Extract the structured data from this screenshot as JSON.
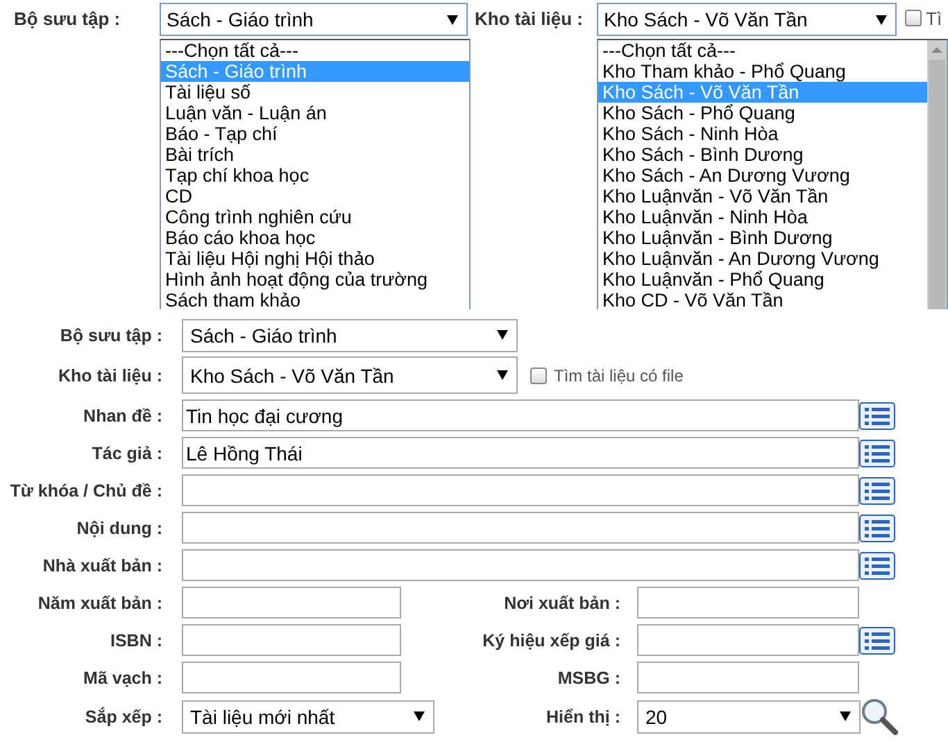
{
  "top": {
    "collection": {
      "label": "Bộ sưu tập :",
      "value": "Sách - Giáo trình",
      "options": [
        {
          "label": "---Chọn tất cả---",
          "selected": false
        },
        {
          "label": "Sách - Giáo trình",
          "selected": true
        },
        {
          "label": "Tài liệu số",
          "selected": false
        },
        {
          "label": "Luận văn - Luận án",
          "selected": false
        },
        {
          "label": "Báo - Tạp chí",
          "selected": false
        },
        {
          "label": "Bài trích",
          "selected": false
        },
        {
          "label": "Tạp chí khoa học",
          "selected": false
        },
        {
          "label": "CD",
          "selected": false
        },
        {
          "label": "Công trình nghiên cứu",
          "selected": false
        },
        {
          "label": "Báo cáo khoa học",
          "selected": false
        },
        {
          "label": "Tài liệu Hội nghị Hội thảo",
          "selected": false
        },
        {
          "label": "Hình ảnh hoạt động của trường",
          "selected": false
        },
        {
          "label": "Sách tham khảo",
          "selected": false
        }
      ]
    },
    "storage": {
      "label": "Kho tài liệu :",
      "value": "Kho Sách - Võ Văn Tần",
      "options": [
        {
          "label": "---Chọn tất cả---",
          "selected": false
        },
        {
          "label": "Kho Tham khảo - Phổ Quang",
          "selected": false
        },
        {
          "label": "Kho Sách - Võ Văn Tần",
          "selected": true
        },
        {
          "label": "Kho Sách - Phổ Quang",
          "selected": false
        },
        {
          "label": "Kho Sách - Ninh Hòa",
          "selected": false
        },
        {
          "label": "Kho Sách - Bình Dương",
          "selected": false
        },
        {
          "label": "Kho Sách - An Dương Vương",
          "selected": false
        },
        {
          "label": "Kho Luậnvăn - Võ Văn Tần",
          "selected": false
        },
        {
          "label": "Kho Luậnvăn - Ninh Hòa",
          "selected": false
        },
        {
          "label": "Kho Luậnvăn - Bình Dương",
          "selected": false
        },
        {
          "label": "Kho Luậnvăn - An Dương Vương",
          "selected": false
        },
        {
          "label": "Kho Luậnvăn - Phổ Quang",
          "selected": false
        },
        {
          "label": "Kho CD - Võ Văn Tần",
          "selected": false
        }
      ]
    },
    "file_checkbox": {
      "label": "Tì",
      "checked": false
    }
  },
  "form": {
    "collection": {
      "label": "Bộ sưu tập :",
      "value": "Sách - Giáo trình"
    },
    "storage": {
      "label": "Kho tài liệu :",
      "value": "Kho Sách - Võ Văn Tần"
    },
    "file_checkbox": {
      "label": "Tìm tài liệu có file",
      "checked": false
    },
    "full_fields": [
      {
        "label": "Nhan đề :",
        "value": "Tin học đại cương"
      },
      {
        "label": "Tác giả :",
        "value": "Lê Hồng Thái"
      },
      {
        "label": "Từ khóa / Chủ đề :"
      },
      {
        "label": "Nội dung :"
      },
      {
        "label": "Nhà xuất bản :"
      }
    ],
    "pair_rows": [
      {
        "left": {
          "label": "Năm xuất bản :"
        },
        "right": {
          "label": "Nơi xuất bản :",
          "lookup": false
        }
      },
      {
        "left": {
          "label": "ISBN :"
        },
        "right": {
          "label": "Ký hiệu xếp giá :",
          "lookup": true
        }
      },
      {
        "left": {
          "label": "Mã vạch :"
        },
        "right": {
          "label": "MSBG :",
          "lookup": false
        }
      }
    ],
    "sort": {
      "label": "Sắp xếp :",
      "value": "Tài liệu mới nhất"
    },
    "display": {
      "label": "Hiển thị :",
      "value": "20"
    }
  }
}
